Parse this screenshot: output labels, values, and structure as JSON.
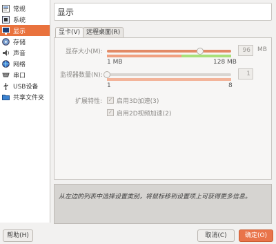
{
  "sidebar": {
    "items": [
      {
        "label": "常规",
        "icon": "general-icon"
      },
      {
        "label": "系统",
        "icon": "system-icon"
      },
      {
        "label": "显示",
        "icon": "display-icon"
      },
      {
        "label": "存储",
        "icon": "storage-icon"
      },
      {
        "label": "声音",
        "icon": "audio-icon"
      },
      {
        "label": "网络",
        "icon": "network-icon"
      },
      {
        "label": "串口",
        "icon": "serial-icon"
      },
      {
        "label": "USB设备",
        "icon": "usb-icon"
      },
      {
        "label": "共享文件夹",
        "icon": "shared-folder-icon"
      }
    ],
    "selected_index": 2
  },
  "page": {
    "title": "显示"
  },
  "tabs": [
    {
      "label": "显卡(V)"
    },
    {
      "label": "远程桌面(R)"
    }
  ],
  "video": {
    "memory_label": "显存大小(M):",
    "memory_value": "96",
    "memory_unit": "MB",
    "memory_min": "1 MB",
    "memory_max": "128 MB",
    "memory_fraction": 0.75,
    "monitor_label": "监视器数量(N):",
    "monitor_value": "1",
    "monitor_min": "1",
    "monitor_max": "8",
    "monitor_fraction": 0.0,
    "extended_label": "扩展特性:",
    "accel3d_label": "启用3D加速(3)",
    "accel2d_label": "启用2D视频加速(2)"
  },
  "info_text": "从左边的列表中选择设置类别，将鼠标移到设置项上可获得更多信息。",
  "buttons": {
    "help": "帮助(H)",
    "cancel": "取消(C)",
    "ok": "确定(O)"
  },
  "colors": {
    "accent": "#e9723d",
    "slider_warn": "#f0a080",
    "slider_ok": "#a8e07a"
  }
}
